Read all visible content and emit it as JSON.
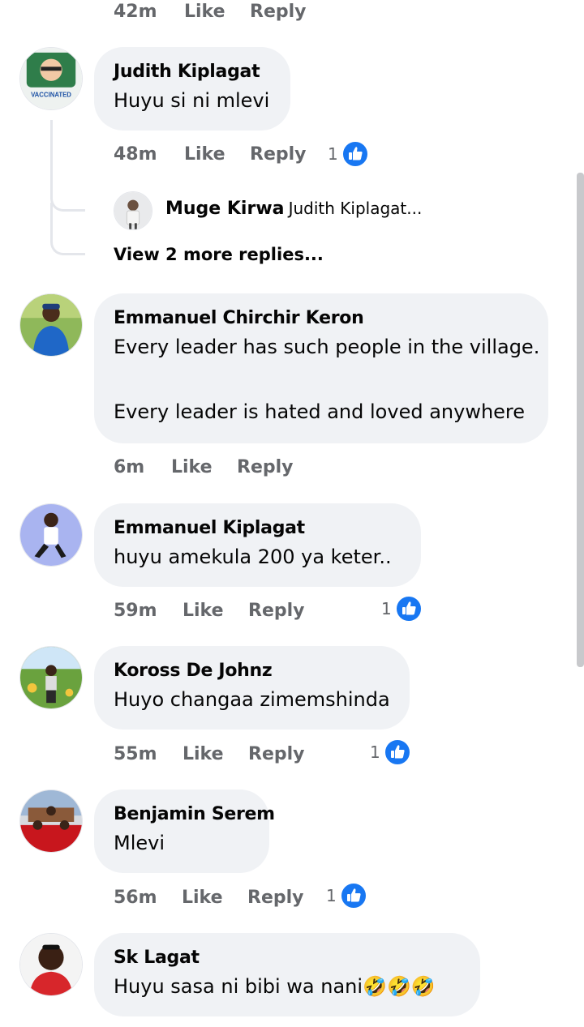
{
  "top_meta": {
    "time": "42m",
    "like": "Like",
    "reply": "Reply"
  },
  "comments": [
    {
      "name": "Judith Kiplagat",
      "lines": [
        "Huyu si ni mlevi"
      ],
      "meta": {
        "time": "48m",
        "like": "Like",
        "reply": "Reply"
      },
      "reactions": "1",
      "avatar_badge": "VACCINATED"
    },
    {
      "name": "Emmanuel Chirchir Keron",
      "lines": [
        "Every leader has such people in the village.",
        "",
        "Every leader is hated and loved anywhere"
      ],
      "meta": {
        "time": "6m",
        "like": "Like",
        "reply": "Reply"
      }
    },
    {
      "name": "Emmanuel Kiplagat",
      "lines": [
        "huyu amekula 200 ya keter.."
      ],
      "meta": {
        "time": "59m",
        "like": "Like",
        "reply": "Reply"
      },
      "reactions": "1"
    },
    {
      "name": "Koross De Johnz",
      "lines": [
        "Huyo changaa zimemshinda"
      ],
      "meta": {
        "time": "55m",
        "like": "Like",
        "reply": "Reply"
      },
      "reactions": "1"
    },
    {
      "name": "Benjamin Serem",
      "lines": [
        "Mlevi"
      ],
      "meta": {
        "time": "56m",
        "like": "Like",
        "reply": "Reply"
      },
      "reactions": "1"
    },
    {
      "name": "Sk Lagat",
      "lines": [
        "Huyu sasa ni bibi wa nani"
      ],
      "emoji": "🤣🤣🤣"
    }
  ],
  "reply_preview": {
    "name": "Muge Kirwa",
    "text": "Judith Kiplagat..."
  },
  "view_more": "View 2 more replies...",
  "colors": {
    "bubble": "#f0f2f5",
    "meta": "#65676b",
    "like_blue": "#1877f2"
  }
}
